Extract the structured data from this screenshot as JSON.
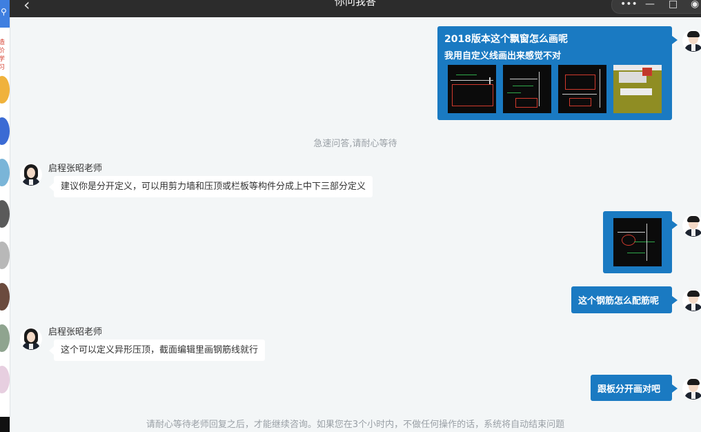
{
  "window": {
    "title": "你问我答",
    "controls": [
      "more-icon",
      "minimize-icon",
      "restore-icon",
      "record-icon"
    ]
  },
  "background_page": {
    "text_lines": [
      "造价",
      "学习"
    ]
  },
  "messages": {
    "m1": {
      "line1": "2018版本这个飘窗怎么画呢",
      "line2": "我用自定义线画出来感觉不对",
      "image_count": 4
    },
    "sys1": "急速问答,请耐心等待",
    "t1": {
      "name": "启程张昭老师",
      "text": "建议你是分开定义，可以用剪力墙和压顶或栏板等构件分成上中下三部分定义"
    },
    "m2": {
      "image_count": 1
    },
    "m3": {
      "text": "这个钢筋怎么配筋呢"
    },
    "t2": {
      "name": "启程张昭老师",
      "text": "这个可以定义异形压顶，截面编辑里画钢筋线就行"
    },
    "m4": {
      "text": "跟板分开画对吧"
    },
    "footer": "请耐心等待老师回复之后，才能继续咨询。如果您在3个小时内，不做任何操作的话，系统将自动结束问题"
  },
  "colors": {
    "header": "#2c2c2c",
    "my_bubble": "#1a7ac2",
    "their_bubble": "#ffffff",
    "chat_background": "#f3f6f7"
  }
}
